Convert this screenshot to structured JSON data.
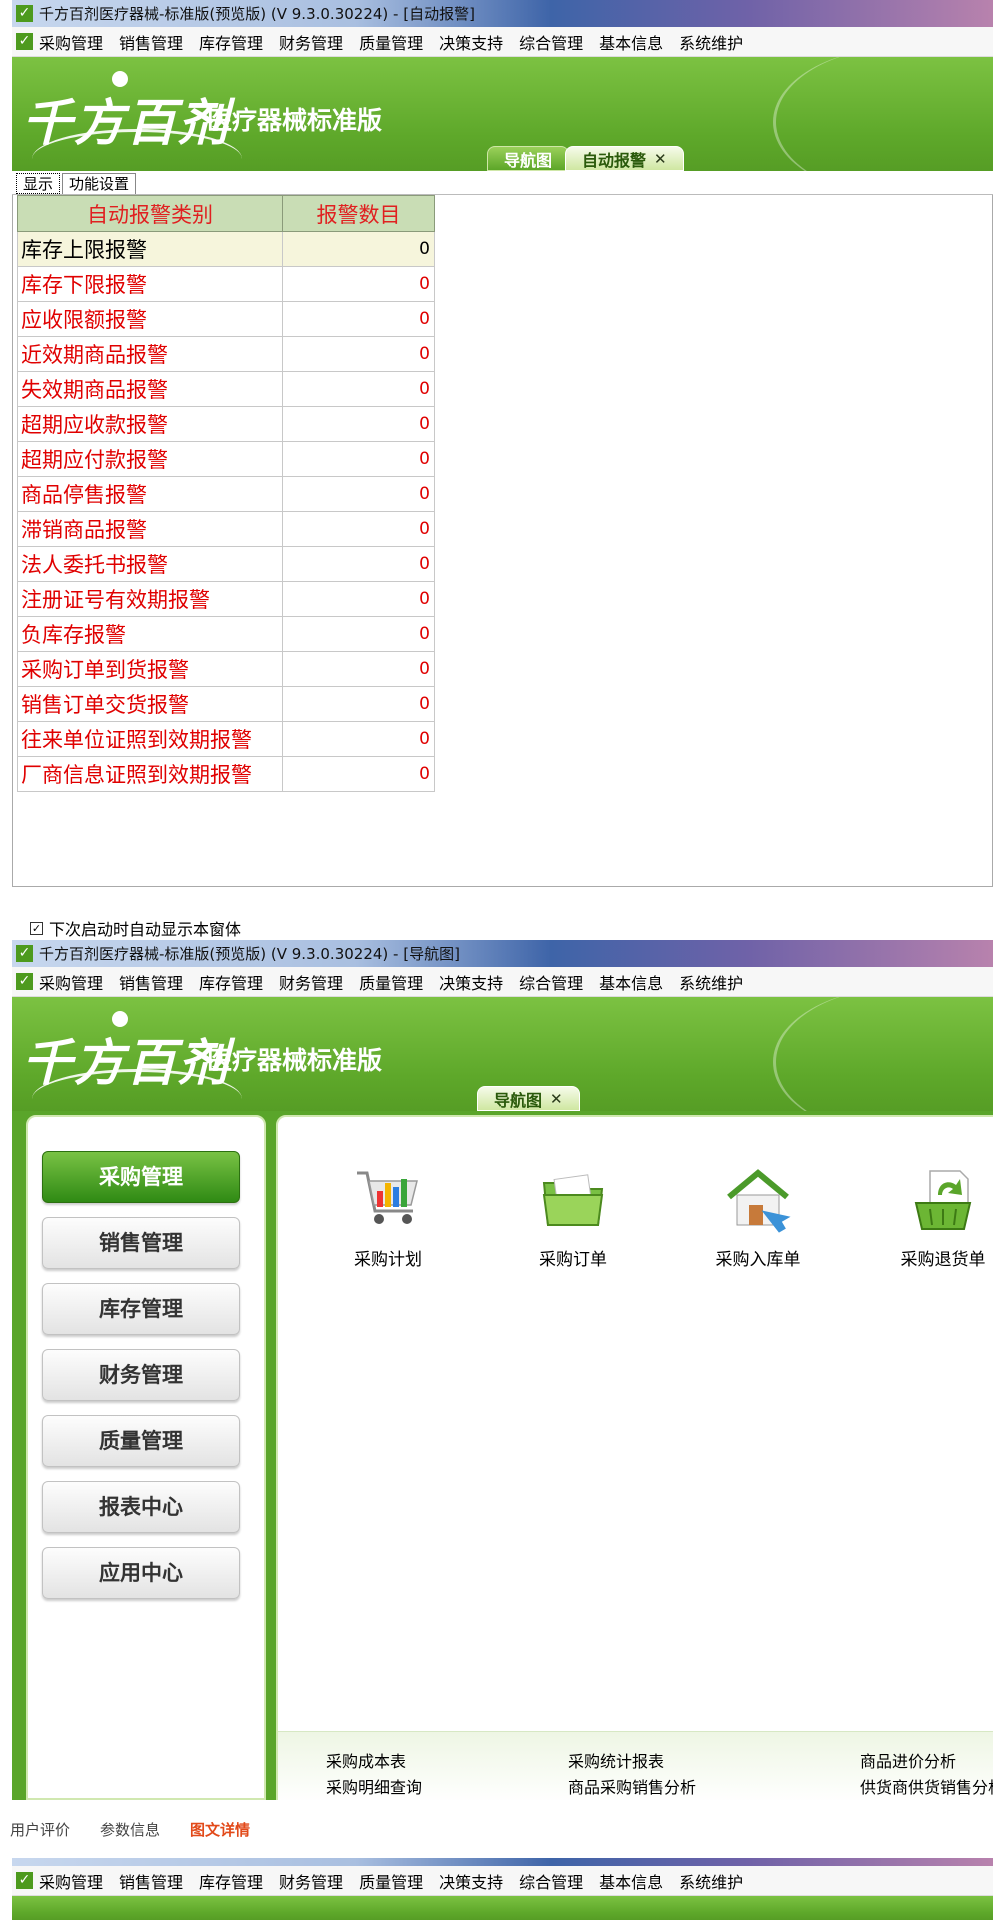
{
  "window1": {
    "title": "千方百剂医疗器械-标准版(预览版) (V 9.3.0.30224)  - [自动报警]",
    "menu": [
      "采购管理",
      "销售管理",
      "库存管理",
      "财务管理",
      "质量管理",
      "决策支持",
      "综合管理",
      "基本信息",
      "系统维护"
    ],
    "logo_text": "千方百剂",
    "logo_subtitle": "医疗器械标准版",
    "tabs": [
      "导航图",
      "自动报警"
    ],
    "subtabs": [
      "显示",
      "功能设置"
    ],
    "table": {
      "headers": [
        "自动报警类别",
        "报警数目"
      ],
      "rows": [
        {
          "category": "库存上限报警",
          "count": "0"
        },
        {
          "category": "库存下限报警",
          "count": "0"
        },
        {
          "category": "应收限额报警",
          "count": "0"
        },
        {
          "category": "近效期商品报警",
          "count": "0"
        },
        {
          "category": "失效期商品报警",
          "count": "0"
        },
        {
          "category": "超期应收款报警",
          "count": "0"
        },
        {
          "category": "超期应付款报警",
          "count": "0"
        },
        {
          "category": "商品停售报警",
          "count": "0"
        },
        {
          "category": "滞销商品报警",
          "count": "0"
        },
        {
          "category": "法人委托书报警",
          "count": "0"
        },
        {
          "category": "注册证号有效期报警",
          "count": "0"
        },
        {
          "category": "负库存报警",
          "count": "0"
        },
        {
          "category": "采购订单到货报警",
          "count": "0"
        },
        {
          "category": "销售订单交货报警",
          "count": "0"
        },
        {
          "category": "往来单位证照到效期报警",
          "count": "0"
        },
        {
          "category": "厂商信息证照到效期报警",
          "count": "0"
        }
      ]
    },
    "checkbox_label": "下次启动时自动显示本窗体"
  },
  "window2": {
    "title": "千方百剂医疗器械-标准版(预览版) (V 9.3.0.30224)  - [导航图]",
    "menu": [
      "采购管理",
      "销售管理",
      "库存管理",
      "财务管理",
      "质量管理",
      "决策支持",
      "综合管理",
      "基本信息",
      "系统维护"
    ],
    "logo_text": "千方百剂",
    "logo_subtitle": "医疗器械标准版",
    "tabs": [
      "导航图"
    ],
    "nav_buttons": [
      "采购管理",
      "销售管理",
      "库存管理",
      "财务管理",
      "质量管理",
      "报表中心",
      "应用中心"
    ],
    "functions": [
      "采购计划",
      "采购订单",
      "采购入库单",
      "采购退货单"
    ],
    "reports": [
      "采购成本表",
      "采购统计报表",
      "商品进价分析",
      "采购明细查询",
      "商品采购销售分析",
      "供货商供货销售分析"
    ]
  },
  "strip": {
    "tabs": [
      "用户评价",
      "参数信息",
      "图文详情"
    ]
  },
  "window3": {
    "menu": [
      "采购管理",
      "销售管理",
      "库存管理",
      "财务管理",
      "质量管理",
      "决策支持",
      "综合管理",
      "基本信息",
      "系统维护"
    ]
  },
  "colors": {
    "brand_green": "#5ea82a",
    "alarm_red": "#e00000",
    "strip_active": "#e24a1a"
  }
}
